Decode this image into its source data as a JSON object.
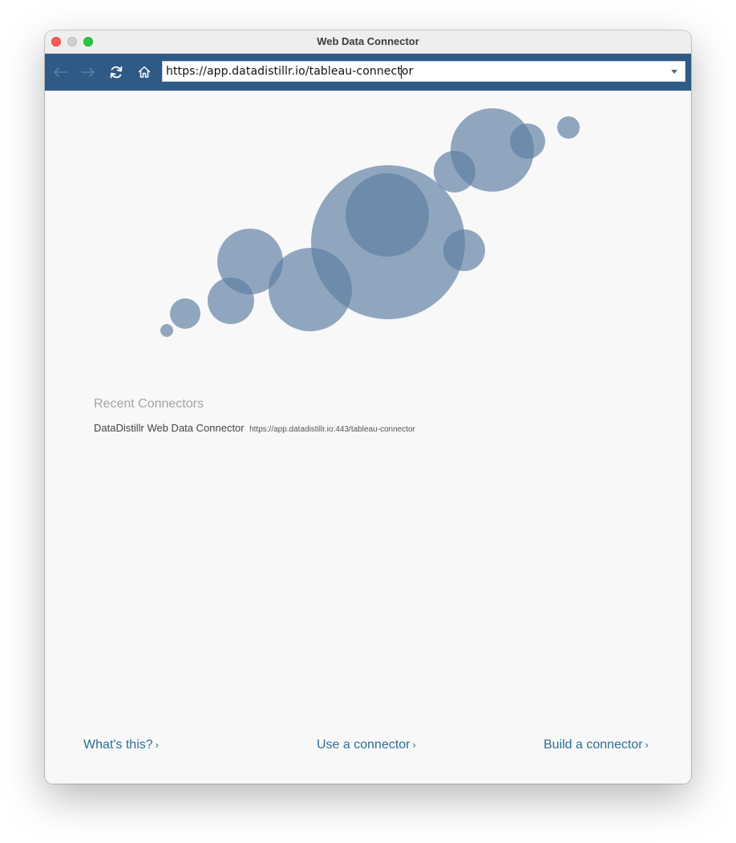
{
  "window": {
    "title": "Web Data Connector"
  },
  "toolbar": {
    "url": "https://app.datadistillr.io/tableau-connector"
  },
  "recent": {
    "heading": "Recent Connectors",
    "items": [
      {
        "name": "DataDistillr Web Data Connector",
        "url": "https://app.datadistillr.io:443/tableau-connector"
      }
    ]
  },
  "footer": {
    "whats_this": "What's this?",
    "use_connector": "Use a connector",
    "build_connector": "Build a connector",
    "chevron": "›"
  },
  "colors": {
    "toolbar_bg": "#2f5a86",
    "bubble": "#5f7fa3",
    "link": "#2b6f94"
  }
}
